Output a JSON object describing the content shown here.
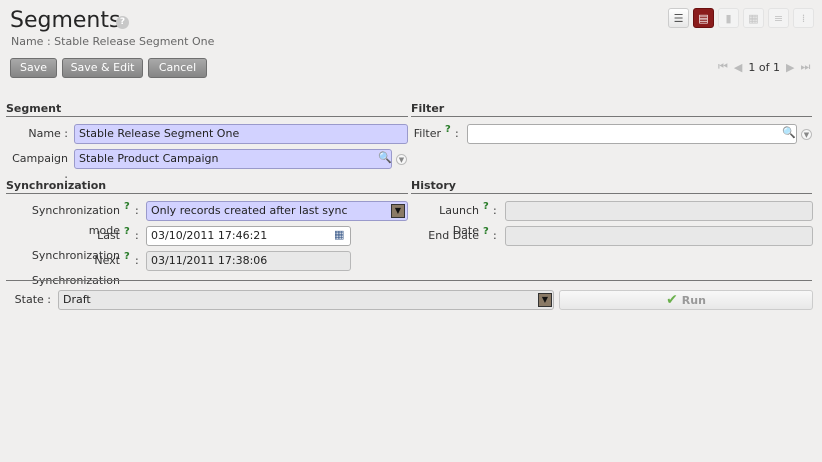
{
  "header": {
    "title": "Segments",
    "help_glyph": "?",
    "subtitle": "Name : Stable Release Segment One"
  },
  "view_switcher": [
    {
      "name": "list-view-icon",
      "glyph": "☰",
      "state": "normal"
    },
    {
      "name": "form-view-icon",
      "glyph": "▤",
      "state": "active"
    },
    {
      "name": "graph-view-icon",
      "glyph": "▮",
      "state": "disabled"
    },
    {
      "name": "calendar-view-icon",
      "glyph": "▦",
      "state": "disabled"
    },
    {
      "name": "gantt-view-icon",
      "glyph": "≡",
      "state": "disabled"
    },
    {
      "name": "kanban-view-icon",
      "glyph": "⁞",
      "state": "disabled"
    }
  ],
  "toolbar": {
    "save_label": "Save",
    "save_edit_label": "Save & Edit",
    "cancel_label": "Cancel"
  },
  "pager": {
    "first_glyph": "⏮",
    "prev_glyph": "◀",
    "count": "1 of 1",
    "next_glyph": "▶",
    "last_glyph": "⏭"
  },
  "segment": {
    "heading": "Segment",
    "name_label": "Name :",
    "name_value": "Stable Release Segment One",
    "campaign_label": "Campaign :",
    "campaign_value": "Stable Product Campaign"
  },
  "filter": {
    "heading": "Filter",
    "filter_label": "Filter",
    "colon": ":",
    "help": "?",
    "filter_value": ""
  },
  "synchronization": {
    "heading": "Synchronization",
    "mode_label": "Synchronization mode",
    "mode_value": "Only records created after last sync",
    "last_label": "Last Synchronization",
    "last_value": "03/10/2011 17:46:21",
    "next_label": "Next Synchronization",
    "next_value": "03/11/2011 17:38:06",
    "help": "?",
    "colon": ":"
  },
  "history": {
    "heading": "History",
    "launch_label": "Launch Date",
    "end_label": "End Date",
    "launch_value": "",
    "end_value": "",
    "help": "?",
    "colon": ":"
  },
  "footer": {
    "state_label": "State :",
    "state_value": "Draft",
    "run_label": "Run",
    "run_glyph": "✔"
  },
  "icons": {
    "search": "🔍",
    "dropdown": "▼",
    "calendar": "▦",
    "select": "▼"
  },
  "colors": {
    "required_bg": "#d2d2ff",
    "active_view": "#8a1c1c",
    "help_green": "#2a7d2a"
  }
}
